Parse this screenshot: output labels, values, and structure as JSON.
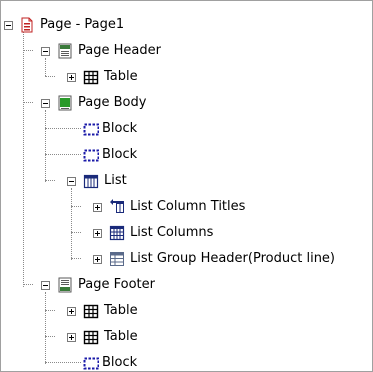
{
  "tree": [
    {
      "label": "Page - Page1",
      "icon": "page-icon",
      "expanded": true
    },
    {
      "label": "Page Header",
      "icon": "page-header-icon",
      "expanded": true
    },
    {
      "label": "Table",
      "icon": "table-icon",
      "expanded": false
    },
    {
      "label": "Page Body",
      "icon": "page-body-icon",
      "expanded": true
    },
    {
      "label": "Block",
      "icon": "block-icon",
      "expanded": null
    },
    {
      "label": "Block",
      "icon": "block-icon",
      "expanded": null
    },
    {
      "label": "List",
      "icon": "list-icon",
      "expanded": true
    },
    {
      "label": "List Column Titles",
      "icon": "list-column-titles-icon",
      "expanded": false
    },
    {
      "label": "List Columns",
      "icon": "list-columns-icon",
      "expanded": false
    },
    {
      "label": "List Group Header(Product line)",
      "icon": "list-group-header-icon",
      "expanded": false
    },
    {
      "label": "Page Footer",
      "icon": "page-footer-icon",
      "expanded": true
    },
    {
      "label": "Table",
      "icon": "table-icon",
      "expanded": false
    },
    {
      "label": "Table",
      "icon": "table-icon",
      "expanded": false
    },
    {
      "label": "Block",
      "icon": "block-icon",
      "expanded": null
    }
  ],
  "colors": {
    "connector": "#8a8a8a",
    "block_border": "#1a1aa8",
    "red": "#c02020",
    "green": "#2a9a2a",
    "navy": "#1a2a7a"
  }
}
